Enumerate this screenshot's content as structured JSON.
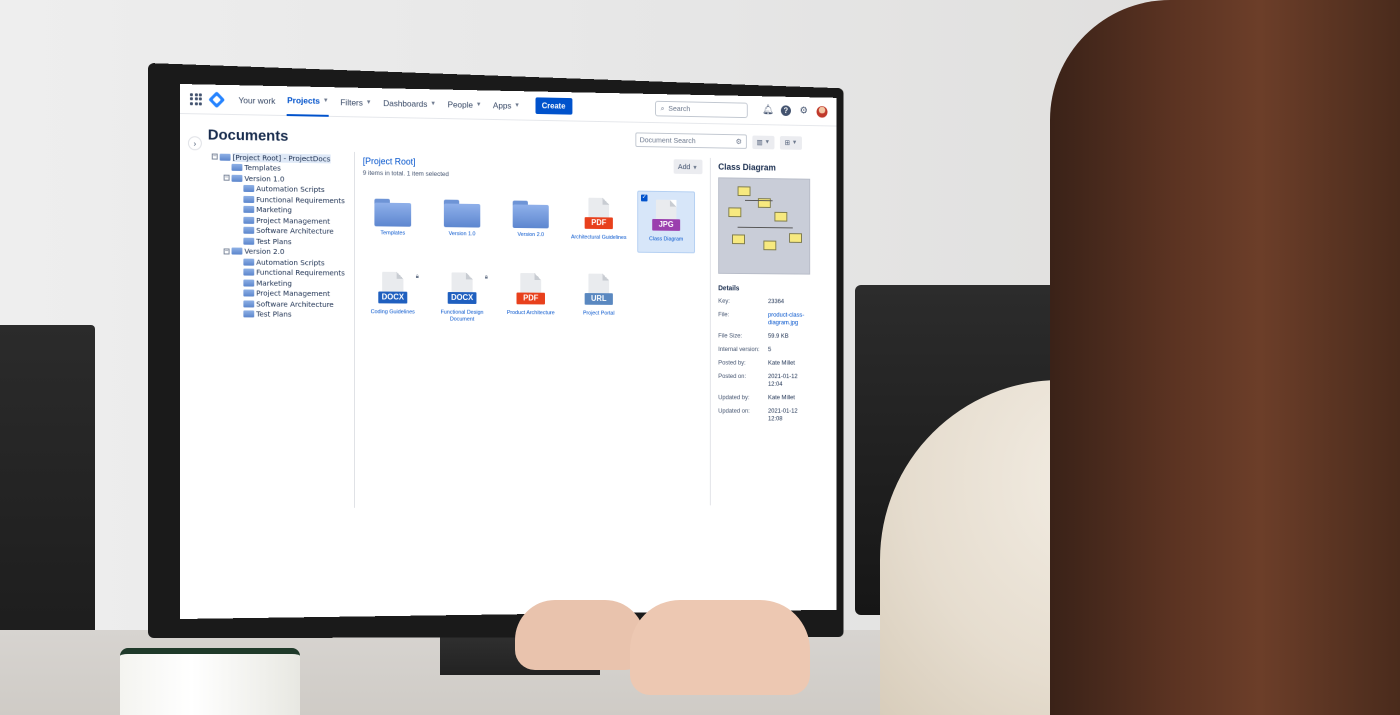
{
  "topnav": {
    "your_work": "Your work",
    "projects": "Projects",
    "filters": "Filters",
    "dashboards": "Dashboards",
    "people": "People",
    "apps": "Apps",
    "create": "Create",
    "search_placeholder": "Search",
    "icons": [
      "apps-grid-icon",
      "product-logo-icon",
      "notifications-icon",
      "help-icon",
      "settings-icon",
      "user-avatar"
    ]
  },
  "page": {
    "title": "Documents",
    "doc_search_placeholder": "Document Search"
  },
  "tree": [
    {
      "label": "[Project Root] - ProjectDocs",
      "level": 0,
      "toggle": "⊟",
      "selected": true
    },
    {
      "label": "Templates",
      "level": 1,
      "toggle": ""
    },
    {
      "label": "Version 1.0",
      "level": 1,
      "toggle": "⊟"
    },
    {
      "label": "Automation Scripts",
      "level": 2,
      "toggle": ""
    },
    {
      "label": "Functional Requirements",
      "level": 2,
      "toggle": ""
    },
    {
      "label": "Marketing",
      "level": 2,
      "toggle": ""
    },
    {
      "label": "Project Management",
      "level": 2,
      "toggle": ""
    },
    {
      "label": "Software Architecture",
      "level": 2,
      "toggle": ""
    },
    {
      "label": "Test Plans",
      "level": 2,
      "toggle": ""
    },
    {
      "label": "Version 2.0",
      "level": 1,
      "toggle": "⊟"
    },
    {
      "label": "Automation Scripts",
      "level": 2,
      "toggle": ""
    },
    {
      "label": "Functional Requirements",
      "level": 2,
      "toggle": ""
    },
    {
      "label": "Marketing",
      "level": 2,
      "toggle": ""
    },
    {
      "label": "Project Management",
      "level": 2,
      "toggle": ""
    },
    {
      "label": "Software Architecture",
      "level": 2,
      "toggle": ""
    },
    {
      "label": "Test Plans",
      "level": 2,
      "toggle": ""
    }
  ],
  "main": {
    "breadcrumb": "[Project Root]",
    "count_text": "9 items in total. 1 item selected",
    "add_label": "Add",
    "items": [
      {
        "label": "Templates",
        "kind": "folder"
      },
      {
        "label": "Version 1.0",
        "kind": "folder"
      },
      {
        "label": "Version 2.0",
        "kind": "folder"
      },
      {
        "label": "Architectural Guidelines",
        "kind": "file",
        "badge": "PDF",
        "color": "#e8401c"
      },
      {
        "label": "Class Diagram",
        "kind": "file",
        "badge": "JPG",
        "color": "#9b3fae",
        "selected": true
      },
      {
        "label": "Coding Guidelines",
        "kind": "file",
        "badge": "DOCX",
        "color": "#1f5fbf",
        "locked": true
      },
      {
        "label": "Functional Design Document",
        "kind": "file",
        "badge": "DOCX",
        "color": "#1f5fbf",
        "locked": true
      },
      {
        "label": "Product Architecture",
        "kind": "file",
        "badge": "PDF",
        "color": "#e8401c"
      },
      {
        "label": "Project Portal",
        "kind": "file",
        "badge": "URL",
        "color": "#5a88c0"
      }
    ]
  },
  "details": {
    "title": "Class Diagram",
    "section": "Details",
    "rows": [
      {
        "key": "Key:",
        "value": "23364"
      },
      {
        "key": "File:",
        "value": "product-class-diagram.jpg",
        "link": true
      },
      {
        "key": "File Size:",
        "value": "59.9 KB"
      },
      {
        "key": "Internal version:",
        "value": "5"
      },
      {
        "key": "Posted by:",
        "value": "Kate Millet"
      },
      {
        "key": "Posted on:",
        "value": "2021-01-12 12:04"
      },
      {
        "key": "Updated by:",
        "value": "Kate Millet"
      },
      {
        "key": "Updated on:",
        "value": "2021-01-12 12:08"
      }
    ]
  }
}
